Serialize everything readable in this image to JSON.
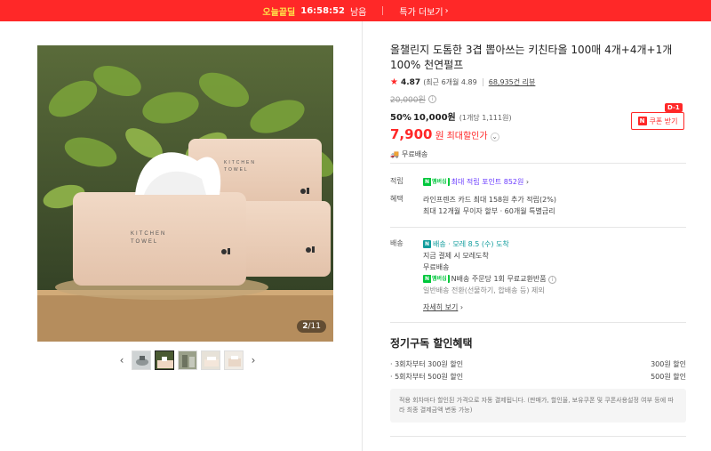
{
  "topbar": {
    "brand": "오늘끝딜",
    "time": "16:58:52",
    "time_suffix": "남음",
    "deal_link": "특가 더보기"
  },
  "gallery": {
    "counter_current": "2",
    "counter_total": "/11",
    "thumbnail_count": 5,
    "active_thumbnail": 2,
    "main_image_texts": [
      "KITCHEN",
      "TOWEL",
      "KITCHEN",
      "TOWEL"
    ]
  },
  "product": {
    "title": "올챌린지 도톰한 3겹 뽑아쓰는 키친타올 100매 4개+4개+1개 100% 천연펄프",
    "rating": "4.87",
    "rating_detail": "(최근 6개월 4.89",
    "review_count": "68,935건 리뷰",
    "original_price": "20,000원",
    "discount_pct": "50%",
    "discount_price": "10,000원",
    "unit_price": "(1개당 1,111원)",
    "max_discount_price": "7,900",
    "max_discount_won": "원",
    "max_discount_label": "최대할인가",
    "shipping": "무료배송",
    "coupon_label": "쿠폰 받기",
    "coupon_badge": "D-1",
    "coupon_n": "N"
  },
  "benefits": {
    "points_label": "적립",
    "npay_text": "N",
    "npay_plus": "멤버십",
    "points_value": "최대 적립 포인트 852원",
    "benefit_label": "혜택",
    "benefit_line1": "라인프렌즈 카드 최대 158원 추가 적립(2%)",
    "benefit_line2": "최대 12개월 무이자 할부 · 60개월 특별금리"
  },
  "delivery": {
    "label": "배송",
    "arrival_badge": "N",
    "arrival_brand": "배송",
    "arrival_text": "· 모레 8.5 (수) 도착",
    "line1": "지금 결제 시 모레도착",
    "line2": "무료배송",
    "line3": "N배송 주문당 1회 무료교환반품",
    "line4": "일반배송 전환(선물하기, 합배송 등) 제외",
    "more": "자세히 보기"
  },
  "subscription": {
    "title": "정기구독 할인혜택",
    "rows": [
      {
        "left": "· 3회차부터 300원 할인",
        "right": "300원 할인"
      },
      {
        "left": "· 5회차부터 500원 할인",
        "right": "500원 할인"
      }
    ],
    "notice": "적용 회차마다 할인된 가격으로 자동 결제됩니다. (판매가, 할인율, 보유쿠폰 및 쿠폰사용설정 여부 등에 따라 최종 결제금액 변동 가능)"
  },
  "colors": {
    "accent": "#ff2828",
    "npay_green": "#00c73c",
    "points_purple": "#6b3cff"
  }
}
